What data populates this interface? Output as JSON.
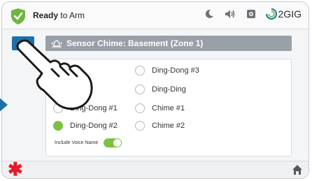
{
  "status": {
    "bold": "Ready",
    "rest": " to Arm"
  },
  "header": {
    "icons": [
      "moon-icon",
      "volume-icon",
      "camera-icon"
    ],
    "brand": "2GIG"
  },
  "page": {
    "title": "Sensor Chime: Basement (Zone 1)"
  },
  "chime_options": [
    {
      "label": "Ding-Dong #3",
      "selected": false
    },
    {
      "label": "Ding-Ding",
      "selected": false
    },
    {
      "label": "Ding-Dong #1",
      "selected": false
    },
    {
      "label": "Chime #1",
      "selected": false
    },
    {
      "label": "Ding-Dong #2",
      "selected": true
    },
    {
      "label": "Chime #2",
      "selected": false
    }
  ],
  "voice": {
    "label": "Include Voice Name",
    "enabled": true
  },
  "colors": {
    "accent_blue": "#1f6fa8",
    "selected_green": "#7cc242",
    "alert_red": "#e21b2d",
    "title_bar_gray": "#9aa0a8"
  }
}
